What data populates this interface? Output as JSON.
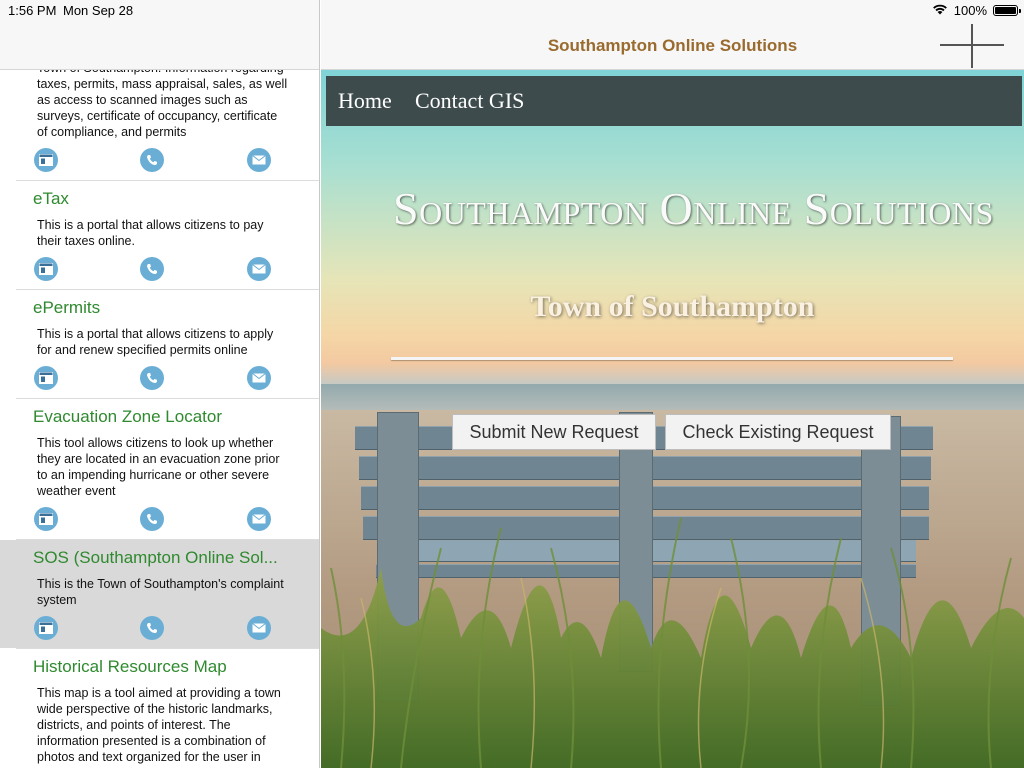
{
  "status_bar": {
    "time": "1:56 PM",
    "date": "Mon Sep 28",
    "battery_percent": "100%",
    "battery_level": 1.0
  },
  "detail_nav": {
    "title": "Southampton Online Solutions",
    "add_icon": "plus-icon"
  },
  "list": {
    "action_icons": [
      "web-icon",
      "phone-icon",
      "mail-icon"
    ],
    "items": [
      {
        "title": "",
        "description": "Town of Southampton. Information regarding taxes, permits, mass appraisal, sales, as well as access to scanned images such as surveys, certificate of occupancy, certificate of compliance, and permits",
        "selected": false
      },
      {
        "title": "eTax",
        "description": "This is a portal that allows citizens to pay their taxes online.",
        "selected": false
      },
      {
        "title": "ePermits",
        "description": "This is a portal that allows citizens to apply for and renew specified permits online",
        "selected": false
      },
      {
        "title": "Evacuation Zone Locator",
        "description": "This tool allows citizens to look up whether they are located in an evacuation zone prior to an impending hurricane or other severe weather event",
        "selected": false
      },
      {
        "title": "SOS (Southampton Online Sol...",
        "description": "This is the Town of Southampton's complaint system",
        "selected": true
      },
      {
        "title": "Historical Resources Map",
        "description": "This map is a tool aimed at providing a town wide perspective of the historic landmarks, districts, and points of interest. The information presented is a combination of photos and text organized for the user in",
        "selected": false
      }
    ]
  },
  "web": {
    "nav": {
      "home": "Home",
      "contact": "Contact GIS"
    },
    "hero_title": "Southampton Online Solutions",
    "hero_subtitle": "Town of Southampton",
    "submit_button": "Submit New Request",
    "check_button": "Check Existing Request"
  },
  "colors": {
    "list_title": "#2f8a2f",
    "nav_title": "#9a6b2f",
    "action_icon_bg": "#6aaed6",
    "selected_row": "#d9d9d9",
    "site_nav_bg": "#3d4b4c"
  }
}
